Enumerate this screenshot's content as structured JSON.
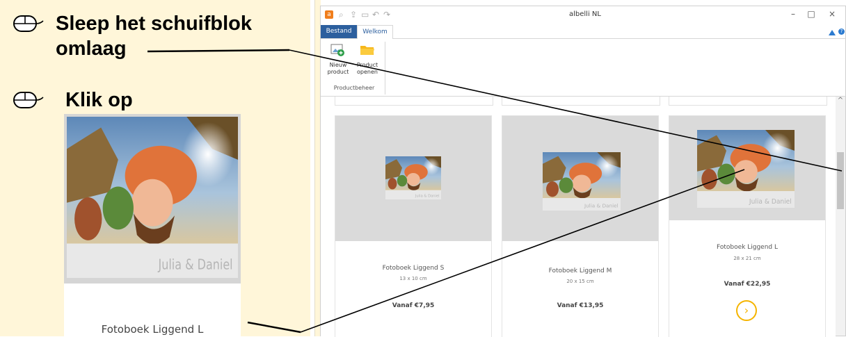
{
  "instructions": {
    "step1": "Sleep het schuifblok omlaag",
    "step2": "Klik op"
  },
  "zoom": {
    "book_text": "Julia & Daniel",
    "caption": "Fotoboek Liggend L"
  },
  "app": {
    "title": "albelli NL",
    "logo": "a",
    "window_buttons": [
      "–",
      "□",
      "×"
    ],
    "tabs": [
      "Bestand",
      "Welkom"
    ],
    "help": "?",
    "ribbon": {
      "buttons": [
        {
          "label_1": "Nieuw",
          "label_2": "product",
          "icon": "new-product-icon"
        },
        {
          "label_1": "Product",
          "label_2": "openen",
          "icon": "folder-open-icon"
        }
      ],
      "group": "Productbeheer"
    },
    "products": [
      {
        "title": "Fotoboek Liggend S",
        "size": "13 x 10 cm",
        "price": "Vanaf  €7,95",
        "book_text": "Julia & Daniel"
      },
      {
        "title": "Fotoboek Liggend M",
        "size": "20 x 15 cm",
        "price": "Vanaf  €13,95",
        "book_text": "Julia & Daniel"
      },
      {
        "title": "Fotoboek Liggend L",
        "size": "28 x 21 cm",
        "price": "Vanaf  €22,95",
        "book_text": "Julia & Daniel",
        "go": "›"
      }
    ],
    "scroll_up": "^"
  },
  "colors": {
    "instruction_bg": "#fff6d9",
    "accent_blue": "#2c5f9e",
    "accent_yellow": "#f5b400",
    "logo_orange": "#f07e1c"
  }
}
